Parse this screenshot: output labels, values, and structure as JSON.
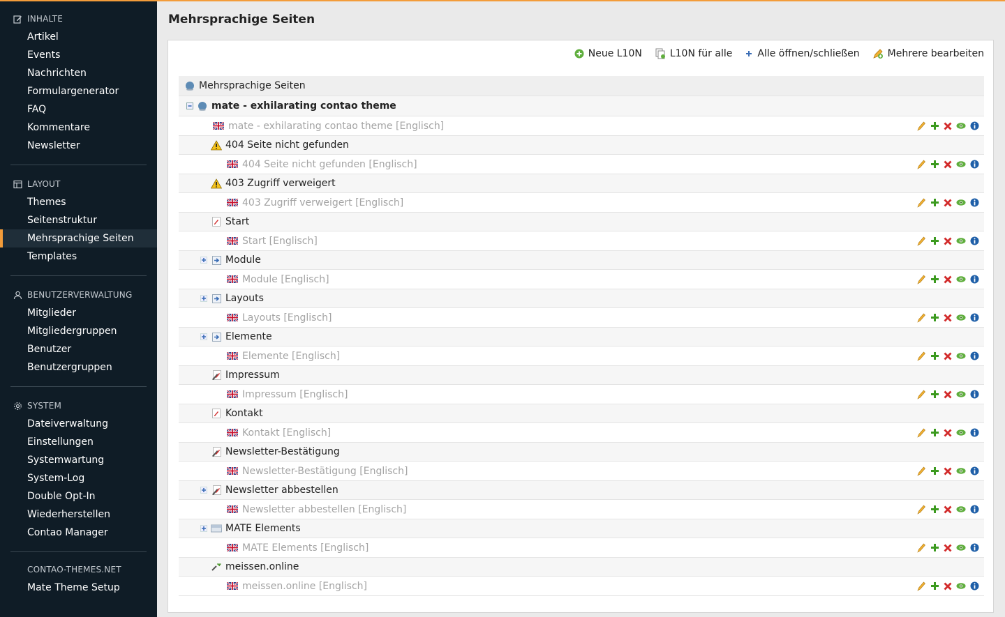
{
  "sidebar": {
    "groups": [
      {
        "title": "INHALTE",
        "icon": "edit-icon",
        "items": [
          "Artikel",
          "Events",
          "Nachrichten",
          "Formulargenerator",
          "FAQ",
          "Kommentare",
          "Newsletter"
        ]
      },
      {
        "title": "LAYOUT",
        "icon": "layout-icon",
        "items": [
          "Themes",
          "Seitenstruktur",
          "Mehrsprachige Seiten",
          "Templates"
        ],
        "active": "Mehrsprachige Seiten"
      },
      {
        "title": "BENUTZERVERWALTUNG",
        "icon": "user-icon",
        "items": [
          "Mitglieder",
          "Mitgliedergruppen",
          "Benutzer",
          "Benutzergruppen"
        ]
      },
      {
        "title": "SYSTEM",
        "icon": "gear-icon",
        "items": [
          "Dateiverwaltung",
          "Einstellungen",
          "Systemwartung",
          "System-Log",
          "Double Opt-In",
          "Wiederherstellen",
          "Contao Manager"
        ]
      },
      {
        "title": "CONTAO-THEMES.NET",
        "icon": "",
        "items": [
          "Mate Theme Setup"
        ]
      }
    ]
  },
  "main": {
    "title": "Mehrsprachige Seiten",
    "toolbar": {
      "new_l10n": "Neue L10N",
      "l10n_all": "L10N für alle",
      "toggle_all": "Alle öffnen/schließen",
      "edit_multiple": "Mehrere bearbeiten"
    },
    "tree": {
      "root_label": "Mehrsprachige Seiten",
      "site_label": "mate - exhilarating contao theme",
      "site_l10n": "mate - exhilarating contao theme [Englisch]",
      "pages": [
        {
          "label": "404 Seite nicht gefunden",
          "icon": "warning-icon",
          "expandable": false,
          "l10n": "404 Seite nicht gefunden [Englisch]"
        },
        {
          "label": "403 Zugriff verweigert",
          "icon": "warning-icon",
          "expandable": false,
          "l10n": "403 Zugriff verweigert [Englisch]"
        },
        {
          "label": "Start",
          "icon": "page-icon",
          "expandable": false,
          "l10n": "Start [Englisch]"
        },
        {
          "label": "Module",
          "icon": "forward-icon",
          "expandable": true,
          "l10n": "Module [Englisch]"
        },
        {
          "label": "Layouts",
          "icon": "forward-icon",
          "expandable": true,
          "l10n": "Layouts [Englisch]"
        },
        {
          "label": "Elemente",
          "icon": "forward-icon",
          "expandable": true,
          "l10n": "Elemente [Englisch]"
        },
        {
          "label": "Impressum",
          "icon": "page-hidden-icon",
          "expandable": false,
          "l10n": "Impressum [Englisch]"
        },
        {
          "label": "Kontakt",
          "icon": "page-icon",
          "expandable": false,
          "l10n": "Kontakt [Englisch]"
        },
        {
          "label": "Newsletter-Bestätigung",
          "icon": "page-hidden-icon",
          "expandable": false,
          "l10n": "Newsletter-Bestätigung [Englisch]"
        },
        {
          "label": "Newsletter abbestellen",
          "icon": "page-hidden-icon",
          "expandable": true,
          "l10n": "Newsletter abbestellen [Englisch]"
        },
        {
          "label": "MATE Elements",
          "icon": "folder-icon",
          "expandable": true,
          "l10n": "MATE Elements [Englisch]"
        },
        {
          "label": "meissen.online",
          "icon": "redirect-icon",
          "expandable": false,
          "l10n": "meissen.online [Englisch]"
        }
      ]
    }
  },
  "colors": {
    "accent": "#f39c3a",
    "sidebar_bg": "#0f1c26",
    "l10n_text": "#a4a4a4"
  }
}
